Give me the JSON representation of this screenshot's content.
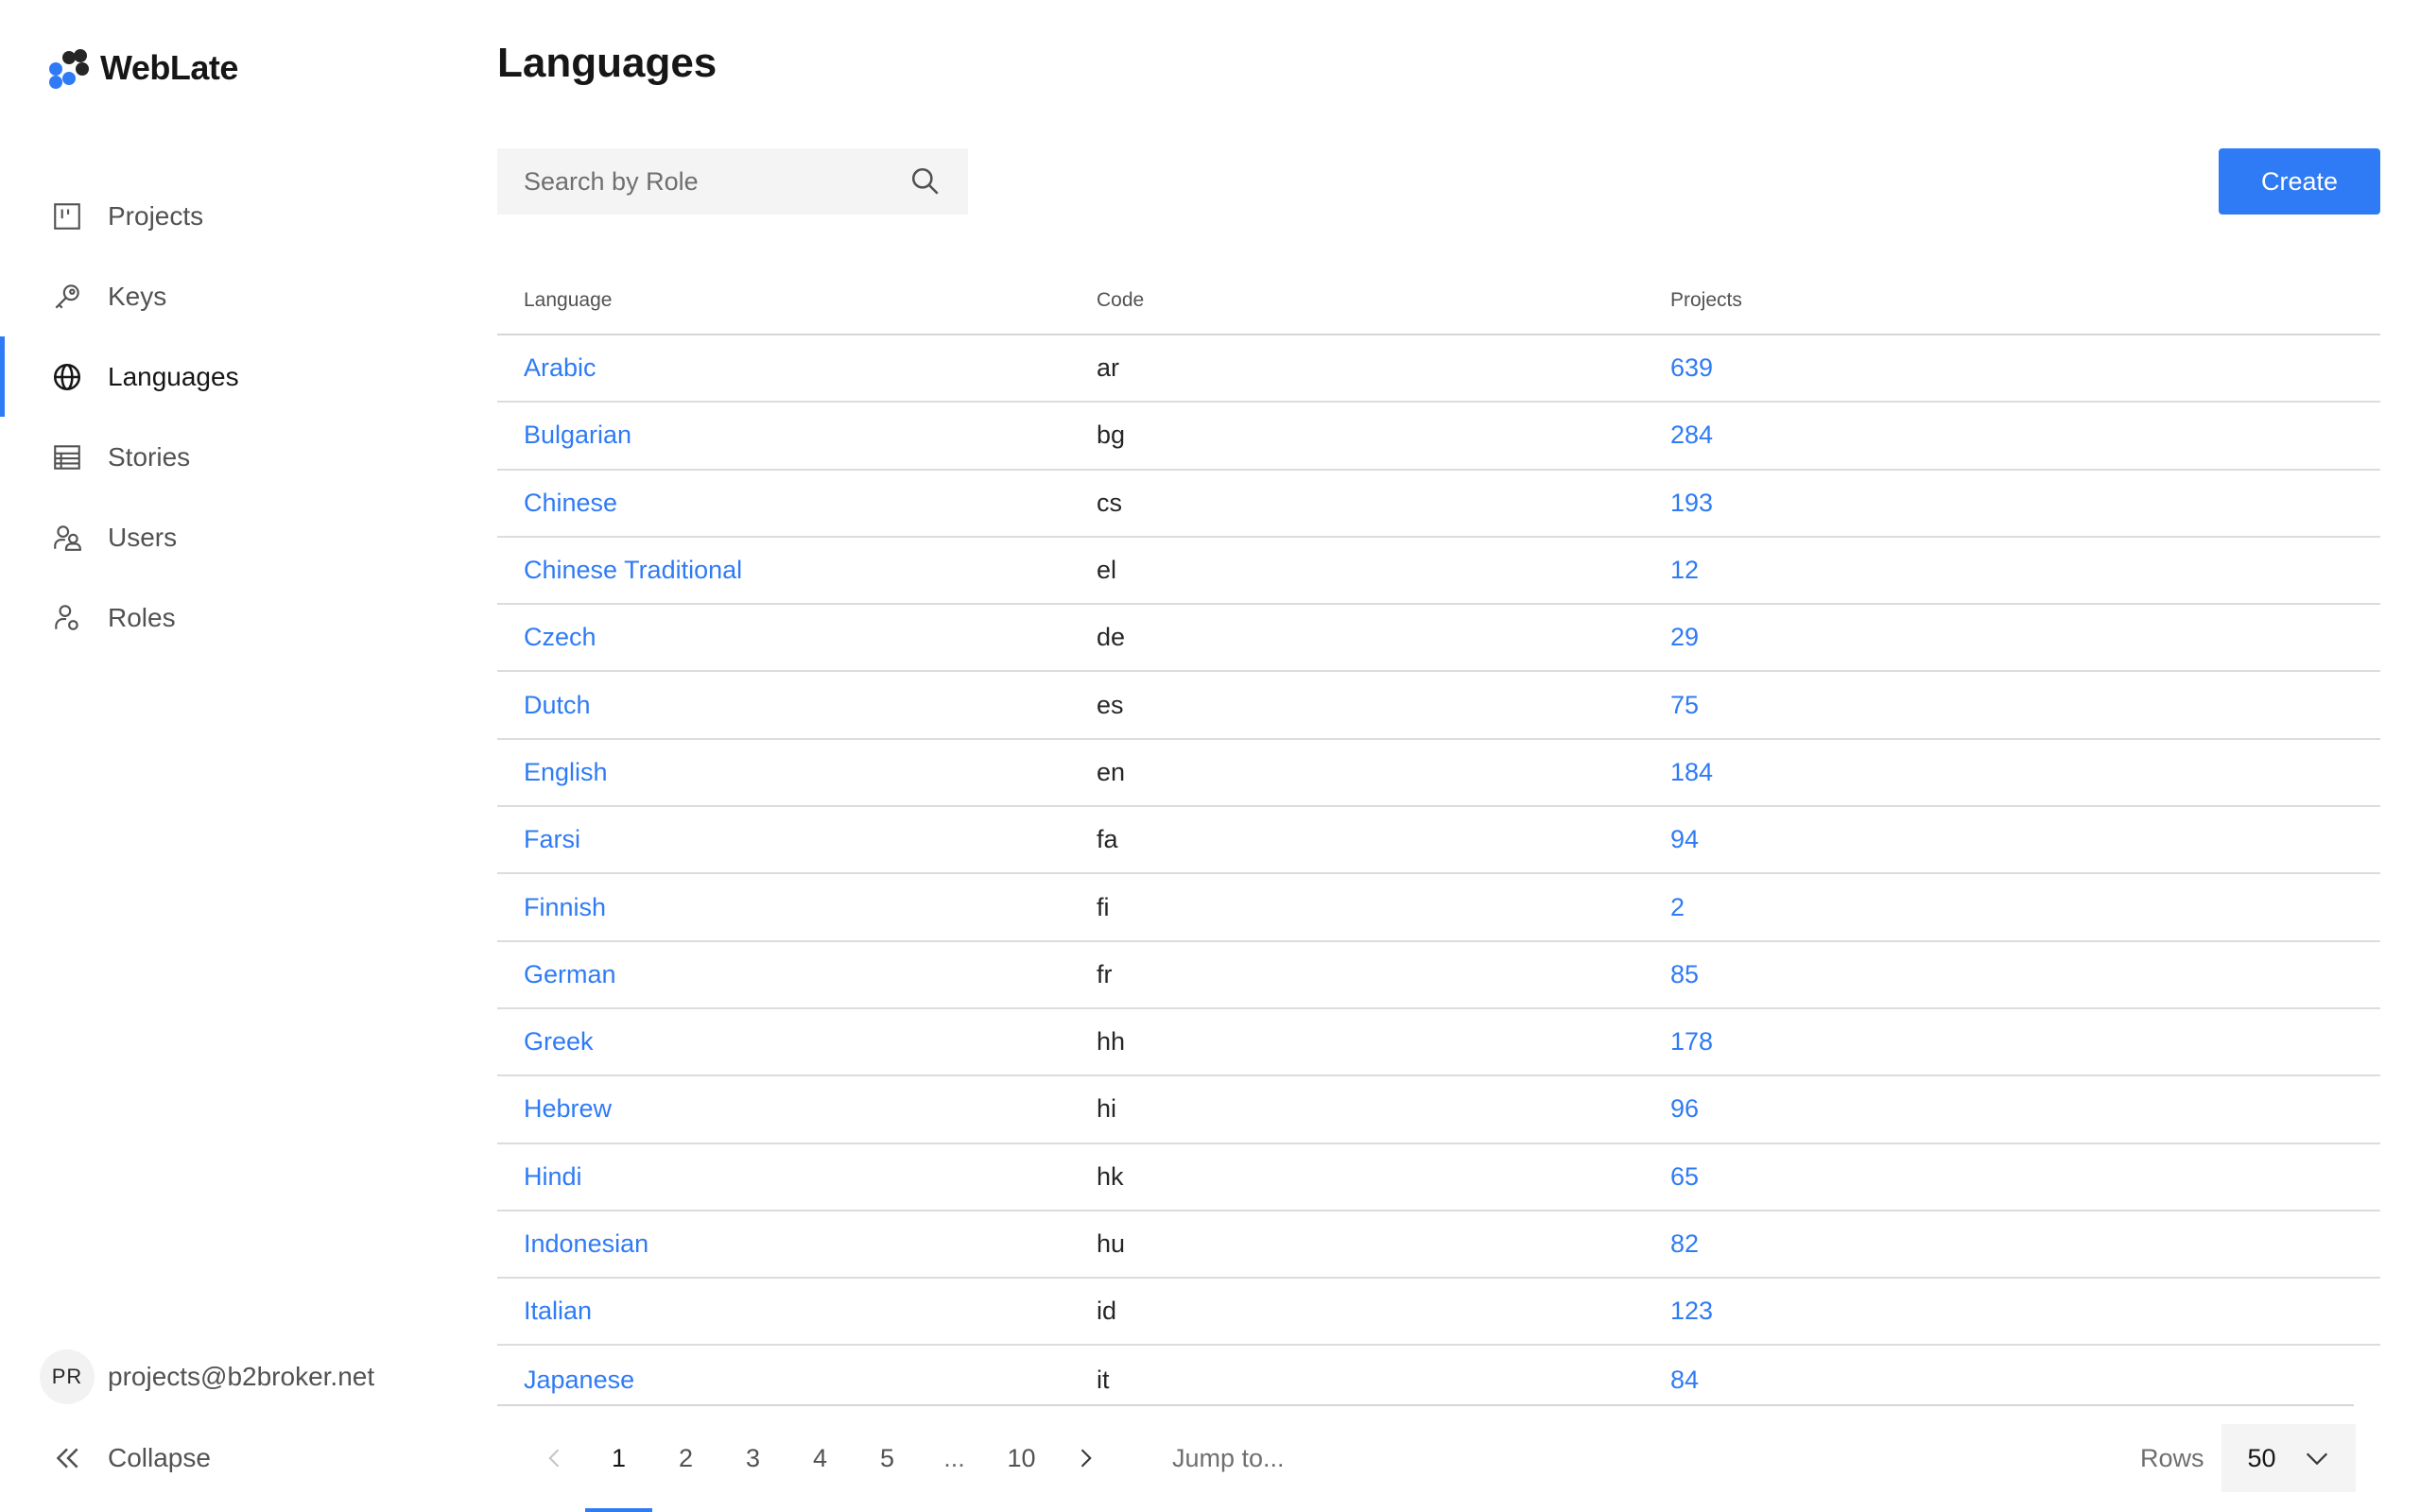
{
  "app": {
    "name": "WebLate"
  },
  "sidebar": {
    "items": [
      {
        "label": "Projects",
        "icon": "projects-board-icon",
        "active": false
      },
      {
        "label": "Keys",
        "icon": "key-icon",
        "active": false
      },
      {
        "label": "Languages",
        "icon": "globe-icon",
        "active": true
      },
      {
        "label": "Stories",
        "icon": "table-list-icon",
        "active": false
      },
      {
        "label": "Users",
        "icon": "users-icon",
        "active": false
      },
      {
        "label": "Roles",
        "icon": "user-role-icon",
        "active": false
      }
    ],
    "user": {
      "initials": "PR",
      "email": "projects@b2broker.net"
    },
    "collapse_label": "Collapse"
  },
  "main": {
    "title": "Languages",
    "search": {
      "placeholder": "Search by Role",
      "value": ""
    },
    "create_label": "Create",
    "table": {
      "headers": [
        "Language",
        "Code",
        "Projects"
      ],
      "rows": [
        {
          "language": "Arabic",
          "code": "ar",
          "projects": "639"
        },
        {
          "language": "Bulgarian",
          "code": "bg",
          "projects": "284"
        },
        {
          "language": "Chinese",
          "code": "cs",
          "projects": "193"
        },
        {
          "language": "Chinese Traditional",
          "code": "el",
          "projects": "12"
        },
        {
          "language": "Czech",
          "code": "de",
          "projects": "29"
        },
        {
          "language": "Dutch",
          "code": "es",
          "projects": "75"
        },
        {
          "language": "English",
          "code": "en",
          "projects": "184"
        },
        {
          "language": "Farsi",
          "code": "fa",
          "projects": "94"
        },
        {
          "language": "Finnish",
          "code": "fi",
          "projects": "2"
        },
        {
          "language": "German",
          "code": "fr",
          "projects": "85"
        },
        {
          "language": "Greek",
          "code": "hh",
          "projects": "178"
        },
        {
          "language": "Hebrew",
          "code": "hi",
          "projects": "96"
        },
        {
          "language": "Hindi",
          "code": "hk",
          "projects": "65"
        },
        {
          "language": "Indonesian",
          "code": "hu",
          "projects": "82"
        },
        {
          "language": "Italian",
          "code": "id",
          "projects": "123"
        },
        {
          "language": "Japanese",
          "code": "it",
          "projects": "84"
        }
      ]
    },
    "pagination": {
      "pages": [
        "1",
        "2",
        "3",
        "4",
        "5"
      ],
      "ellipsis": "...",
      "last_page": "10",
      "current": "1",
      "jump_placeholder": "Jump to...",
      "rows_label": "Rows",
      "rows_value": "50"
    }
  },
  "colors": {
    "accent": "#2f7bf5",
    "text": "#262626",
    "muted": "#525252"
  }
}
